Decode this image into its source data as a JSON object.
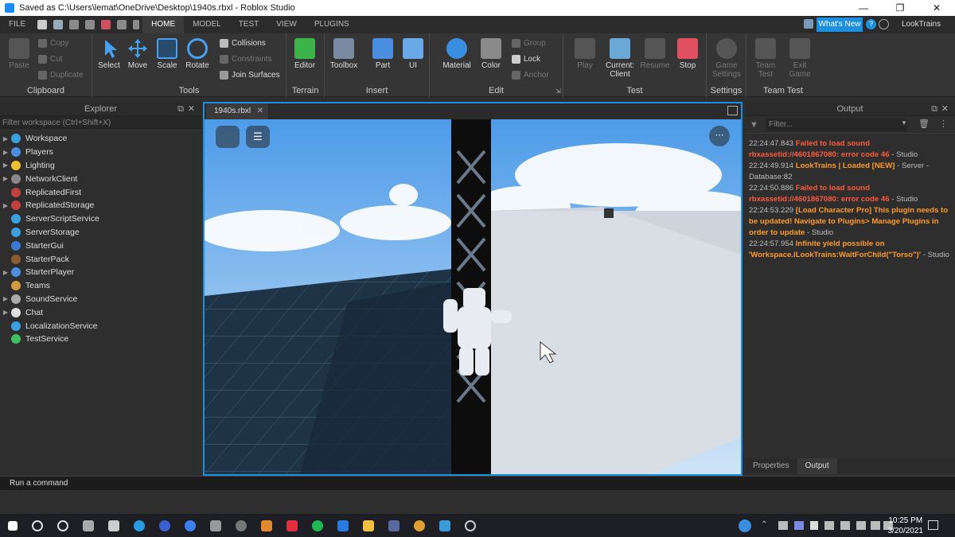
{
  "window": {
    "title": "Saved as C:\\Users\\lemat\\OneDrive\\Desktop\\1940s.rbxl - Roblox Studio",
    "minimize": "—",
    "maximize": "❐",
    "close": "✕"
  },
  "menu": {
    "file": "FILE",
    "tabs": [
      "HOME",
      "MODEL",
      "TEST",
      "VIEW",
      "PLUGINS"
    ],
    "active_tab": "HOME",
    "whats_new": "What's New",
    "user": "LookTrains"
  },
  "ribbon": {
    "clipboard": {
      "label": "Clipboard",
      "paste": "Paste",
      "copy": "Copy",
      "cut": "Cut",
      "duplicate": "Duplicate"
    },
    "tools": {
      "label": "Tools",
      "select": "Select",
      "move": "Move",
      "scale": "Scale",
      "rotate": "Rotate",
      "collisions": "Collisions",
      "constraints": "Constraints",
      "join_surfaces": "Join Surfaces"
    },
    "terrain": {
      "label": "Terrain",
      "editor": "Editor"
    },
    "insert": {
      "label": "Insert",
      "toolbox": "Toolbox",
      "part": "Part",
      "ui": "UI"
    },
    "edit": {
      "label": "Edit",
      "material": "Material",
      "color": "Color",
      "group": "Group",
      "lock": "Lock",
      "anchor": "Anchor"
    },
    "test": {
      "label": "Test",
      "play": "Play",
      "current_client_1": "Current:",
      "current_client_2": "Client",
      "resume": "Resume",
      "stop": "Stop"
    },
    "settings": {
      "label": "Settings",
      "game_1": "Game",
      "game_2": "Settings"
    },
    "team_test": {
      "label": "Team Test",
      "team_1": "Team",
      "team_2": "Test",
      "exit_1": "Exit",
      "exit_2": "Game"
    }
  },
  "explorer": {
    "title": "Explorer",
    "filter_placeholder": "Filter workspace (Ctrl+Shift+X)",
    "items": [
      {
        "label": "Workspace",
        "expandable": true,
        "color": "#3aa0e0"
      },
      {
        "label": "Players",
        "expandable": true,
        "color": "#4a8ee0"
      },
      {
        "label": "Lighting",
        "expandable": true,
        "color": "#f0c030"
      },
      {
        "label": "NetworkClient",
        "expandable": true,
        "color": "#888888"
      },
      {
        "label": "ReplicatedFirst",
        "expandable": false,
        "color": "#c04040"
      },
      {
        "label": "ReplicatedStorage",
        "expandable": true,
        "color": "#c04040"
      },
      {
        "label": "ServerScriptService",
        "expandable": false,
        "color": "#3aa0e0"
      },
      {
        "label": "ServerStorage",
        "expandable": false,
        "color": "#3aa0e0"
      },
      {
        "label": "StarterGui",
        "expandable": false,
        "color": "#3a7ad0"
      },
      {
        "label": "StarterPack",
        "expandable": false,
        "color": "#8a5a30"
      },
      {
        "label": "StarterPlayer",
        "expandable": true,
        "color": "#4a8ee0"
      },
      {
        "label": "Teams",
        "expandable": false,
        "color": "#d09a40"
      },
      {
        "label": "SoundService",
        "expandable": true,
        "color": "#aaaaaa"
      },
      {
        "label": "Chat",
        "expandable": true,
        "color": "#dddddd"
      },
      {
        "label": "LocalizationService",
        "expandable": false,
        "color": "#3aa0e0"
      },
      {
        "label": "TestService",
        "expandable": false,
        "color": "#40c060"
      }
    ]
  },
  "document": {
    "tab": "1940s.rbxl",
    "close": "✕"
  },
  "output": {
    "title": "Output",
    "filter_placeholder": "Filter...",
    "lines": [
      {
        "time": "22:24:47.843",
        "msg": "Failed to load sound rbxassetid://4601867080: error code 46",
        "source": "Studio",
        "kind": "err"
      },
      {
        "time": "22:24:49.914",
        "msg": "LookTrains | Loaded [NEW]",
        "source": "Server - Database:82",
        "kind": "warn"
      },
      {
        "time": "22:24:50.886",
        "msg": "Failed to load sound rbxassetid://4601867080: error code 46",
        "source": "Studio",
        "kind": "err"
      },
      {
        "time": "22:24:53.229",
        "msg": "[Load Character Pro] This plugin needs to be updated! Navigate to Plugins> Manage Plugins in order to update",
        "source": "Studio",
        "kind": "warn"
      },
      {
        "time": "22:24:57.954",
        "msg": "Infinite yield possible on 'Workspace.iLookTrains:WaitForChild(\"Torso\")'",
        "source": "Studio",
        "kind": "warn"
      }
    ],
    "tabs": [
      "Properties",
      "Output"
    ],
    "active_tab": "Output"
  },
  "command": {
    "placeholder": "Run a command"
  },
  "taskbar": {
    "time": "10:25 PM",
    "date": "3/20/2021"
  },
  "colors": {
    "accent": "#1c8fe0",
    "error": "#ff5a3c",
    "warning": "#ff9a2a"
  }
}
